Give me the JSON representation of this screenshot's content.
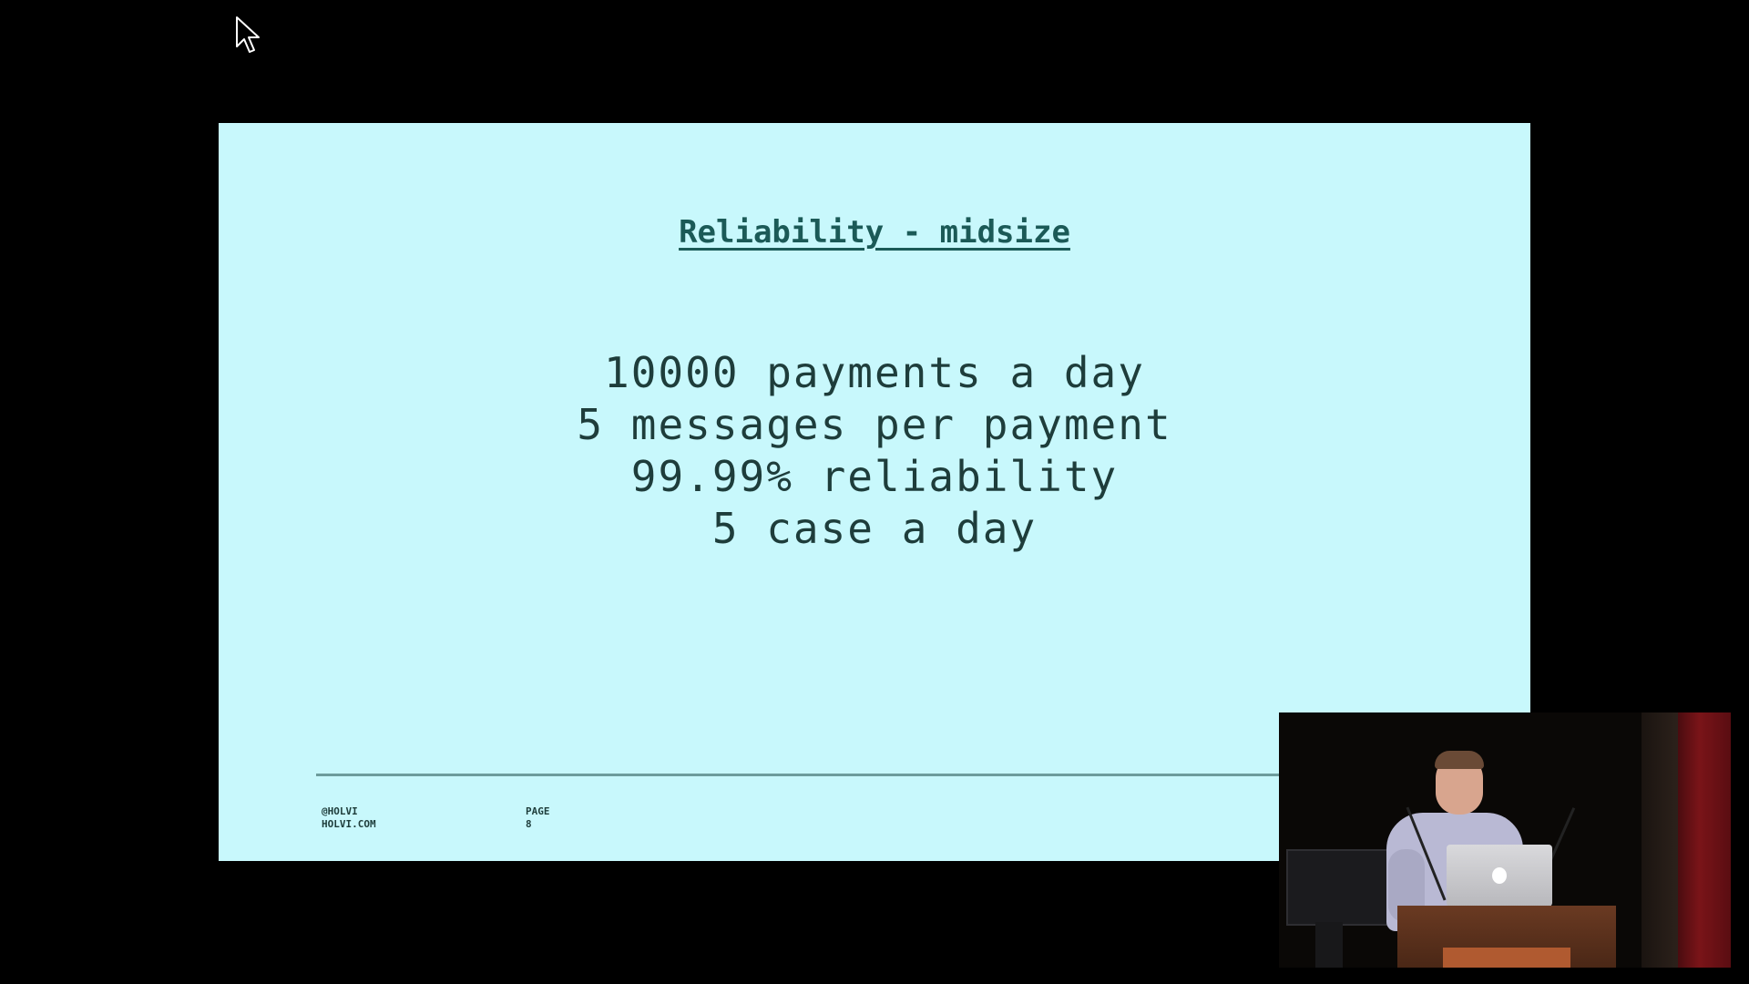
{
  "slide": {
    "title": "Reliability - midsize",
    "lines": [
      "10000 payments a day",
      "5 messages per payment",
      "99.99% reliability",
      "5 case a day"
    ],
    "footer": {
      "handle": "@HOLVI",
      "site": "HOLVI.COM",
      "page_label": "PAGE",
      "page_number": "8"
    }
  },
  "colors": {
    "background": "#000000",
    "slide_background": "#c8f8fc",
    "title_color": "#1b5a57",
    "text_color": "#1e3d3b",
    "rule_color": "#6d9c9c"
  },
  "icons": {
    "cursor": "mouse-pointer-icon"
  }
}
